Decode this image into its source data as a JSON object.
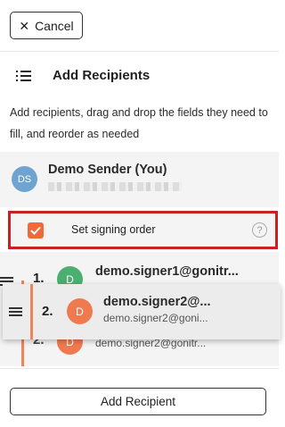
{
  "header": {
    "cancel_label": "Cancel",
    "cancel_icon": "close-icon"
  },
  "section": {
    "title": "Add Recipients",
    "icon": "list-icon"
  },
  "description": "Add recipients, drag and drop the fields they need to fill, and reorder as needed",
  "sender": {
    "initials": "DS",
    "name": "Demo Sender (You)",
    "avatar_color": "#6ea4cf"
  },
  "signing_order": {
    "label": "Set signing order",
    "checked": true,
    "help": "?"
  },
  "signers": [
    {
      "order": "1.",
      "initial": "D",
      "title": "demo.signer1@gonitr...",
      "avatar_color": "#4caf71"
    },
    {
      "order": "2.",
      "initial": "D",
      "title": "demo.signer2@...",
      "subtitle": "demo.signer2@goni...",
      "ghost_subtitle": "demo.signer2@gonitr...",
      "avatar_color": "#f07a50"
    }
  ],
  "footer": {
    "add_recipient_label": "Add Recipient"
  },
  "colors": {
    "accent": "#ee6a3a",
    "highlight_border": "#cc1f1f"
  }
}
